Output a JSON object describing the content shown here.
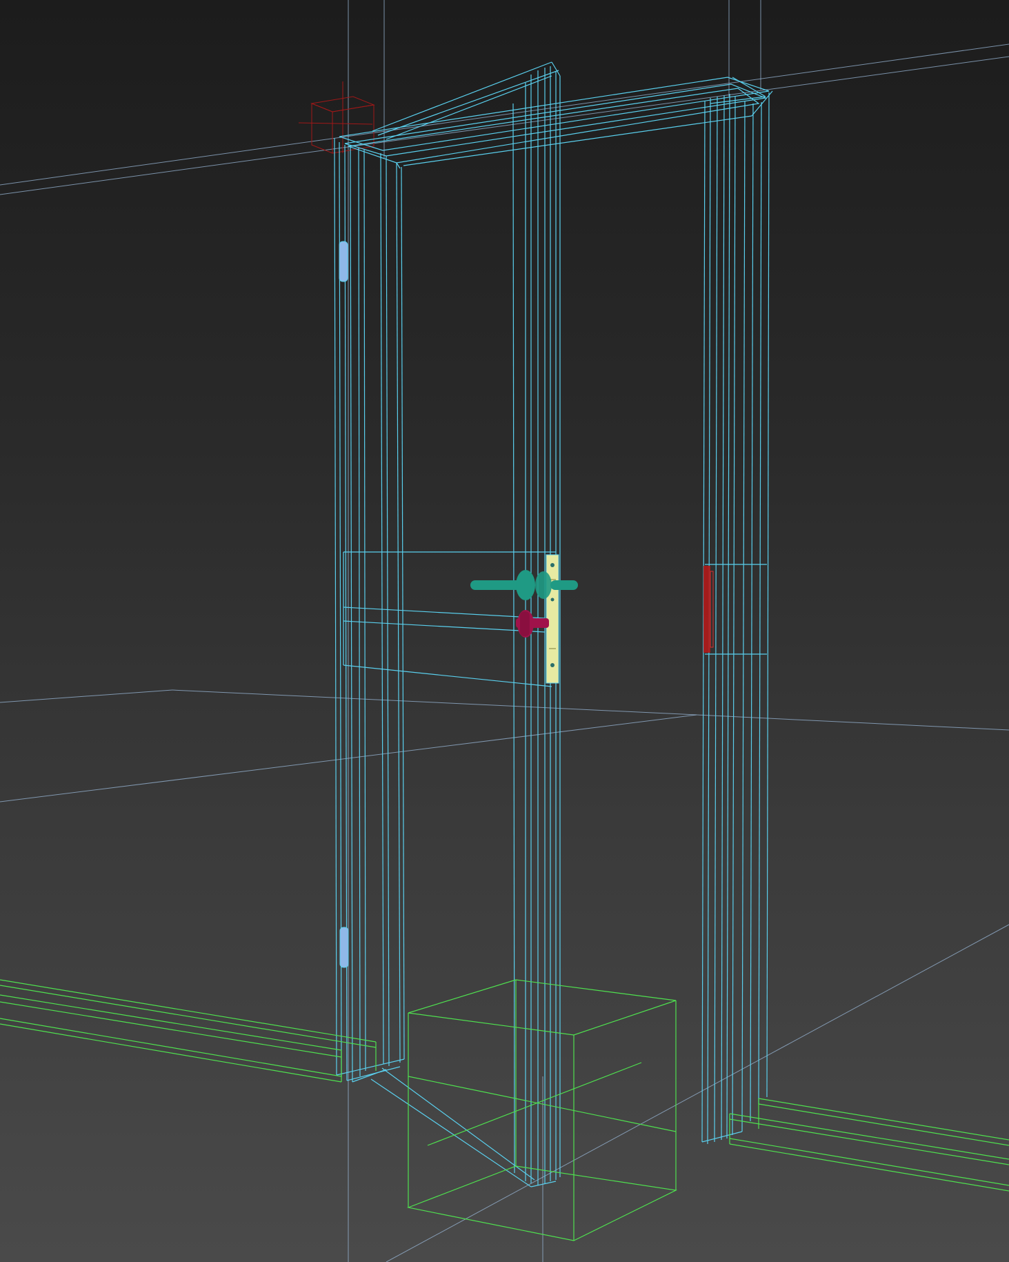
{
  "app": {
    "viewport_type": "3d-wireframe-viewport",
    "render_mode": "wireframe"
  },
  "colors": {
    "background_top": "#1c1c1c",
    "background_bottom": "#4a4a4a",
    "door_frame_wire": "#5ad0ee",
    "box_helper_wire": "#4fe14f",
    "baseboard_wire": "#4fe14f",
    "handle_teal": "#1f9a84",
    "lock_magenta": "#a0124a",
    "escutcheon_plate": "#e7eaa2",
    "hinge": "#8fb8e8",
    "strike_plate": "#b01a1a",
    "pivot_gizmo": "#a01818",
    "grid_line": "#9ab8d8"
  },
  "scene": {
    "objects": [
      {
        "name": "door-frame",
        "icon": "door-frame-wireframe"
      },
      {
        "name": "door-leaf",
        "icon": "door-leaf-wireframe"
      },
      {
        "name": "door-handle",
        "icon": "handle-lever"
      },
      {
        "name": "door-lock",
        "icon": "lock-cylinder"
      },
      {
        "name": "escutcheon-plate",
        "icon": "plate"
      },
      {
        "name": "hinge-top",
        "icon": "hinge"
      },
      {
        "name": "hinge-bottom",
        "icon": "hinge"
      },
      {
        "name": "strike-plate",
        "icon": "strike"
      },
      {
        "name": "helper-box",
        "icon": "bounding-box"
      },
      {
        "name": "baseboard-left",
        "icon": "baseboard"
      },
      {
        "name": "baseboard-right",
        "icon": "baseboard"
      },
      {
        "name": "pivot-gizmo",
        "icon": "transform-gizmo"
      }
    ]
  }
}
